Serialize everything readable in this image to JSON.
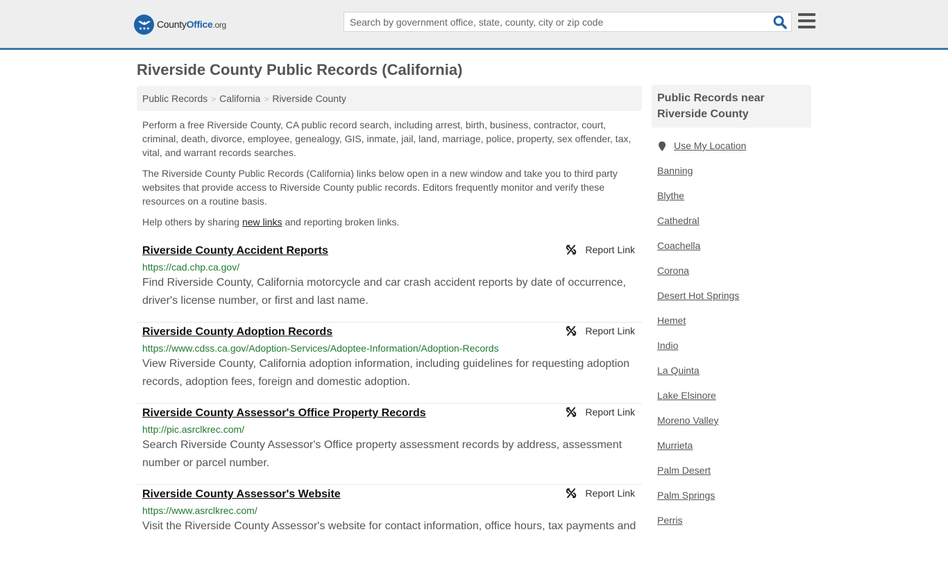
{
  "header": {
    "logo_text_main": "County",
    "logo_text_accent": "Office",
    "logo_text_suffix": ".org",
    "search_placeholder": "Search by government office, state, county, city or zip code",
    "search_value": "",
    "search_icon": "search-icon",
    "menu_icon": "hamburger-menu-icon",
    "accent_color": "#3a7dae",
    "brand_color": "#1e63a8"
  },
  "page": {
    "title": "Riverside County Public Records (California)"
  },
  "breadcrumb": [
    {
      "label": "Public Records"
    },
    {
      "label": "California"
    },
    {
      "label": "Riverside County"
    }
  ],
  "breadcrumb_separator": ">",
  "intro": {
    "p1": "Perform a free Riverside County, CA public record search, including arrest, birth, business, contractor, court, criminal, death, divorce, employee, genealogy, GIS, inmate, jail, land, marriage, police, property, sex offender, tax, vital, and warrant records searches.",
    "p2": "The Riverside County Public Records (California) links below open in a new window and take you to third party websites that provide access to Riverside County public records. Editors frequently monitor and verify these resources on a routine basis.",
    "p3_before": "Help others by sharing ",
    "p3_link": "new links",
    "p3_after": " and reporting broken links."
  },
  "records": [
    {
      "title": "Riverside County Accident Reports",
      "url": "https://cad.chp.ca.gov/",
      "description": "Find Riverside County, California motorcycle and car crash accident reports by date of occurrence, driver's license number, or first and last name.",
      "report_label": "Report Link"
    },
    {
      "title": "Riverside County Adoption Records",
      "url": "https://www.cdss.ca.gov/Adoption-Services/Adoptee-Information/Adoption-Records",
      "description": "View Riverside County, California adoption information, including guidelines for requesting adoption records, adoption fees, foreign and domestic adoption.",
      "report_label": "Report Link"
    },
    {
      "title": "Riverside County Assessor's Office Property Records",
      "url": "http://pic.asrclkrec.com/",
      "description": "Search Riverside County Assessor's Office property assessment records by address, assessment number or parcel number.",
      "report_label": "Report Link"
    },
    {
      "title": "Riverside County Assessor's Website",
      "url": "https://www.asrclkrec.com/",
      "description": "Visit the Riverside County Assessor's website for contact information, office hours, tax payments and",
      "report_label": "Report Link"
    }
  ],
  "sidebar": {
    "heading": "Public Records near Riverside County",
    "use_location": "Use My Location",
    "cities": [
      "Banning",
      "Blythe",
      "Cathedral",
      "Coachella",
      "Corona",
      "Desert Hot Springs",
      "Hemet",
      "Indio",
      "La Quinta",
      "Lake Elsinore",
      "Moreno Valley",
      "Murrieta",
      "Palm Desert",
      "Palm Springs",
      "Perris"
    ]
  }
}
